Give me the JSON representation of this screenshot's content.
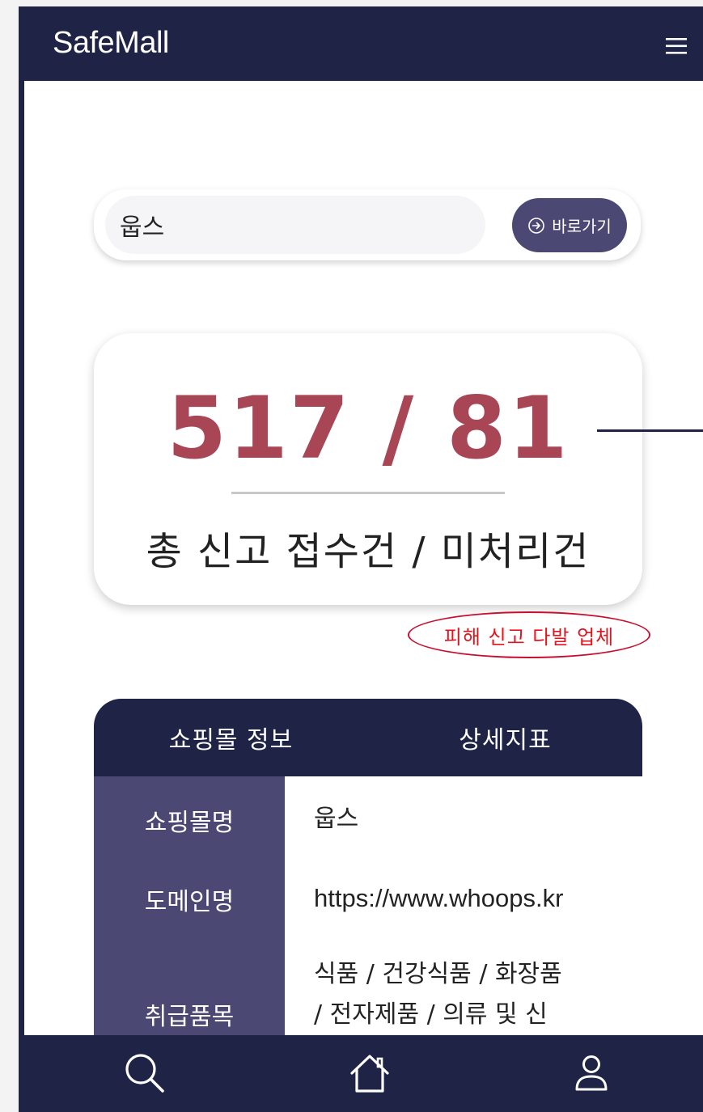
{
  "header": {
    "brand": "SafeMall",
    "menu_icon": "hamburger-menu-icon"
  },
  "search": {
    "value": "웁스",
    "go_label": "바로가기",
    "go_icon": "arrow-circle-right-icon"
  },
  "stats": {
    "number": "517 / 81",
    "caption": "총 신고 접수건 / 미처리건"
  },
  "warning": "피해 신고 다발 업체",
  "info": {
    "tabs": [
      "쇼핑몰 정보",
      "상세지표"
    ],
    "rows": [
      {
        "label": "쇼핑몰명",
        "value": "웁스"
      },
      {
        "label": "도메인명",
        "value": "https://www.whoops.kr"
      },
      {
        "label": "취급품목",
        "value_line1": "식품 / 건강식품 / 화장품",
        "value_line2": "/ 전자제품 / 의류 및 신"
      }
    ]
  },
  "bottom_nav": {
    "items": [
      "search-icon",
      "home-icon",
      "user-icon"
    ]
  },
  "colors": {
    "navy": "#1f2447",
    "purple": "#4b4874",
    "accent_red": "#a84656",
    "warning_red": "#e0141e"
  }
}
